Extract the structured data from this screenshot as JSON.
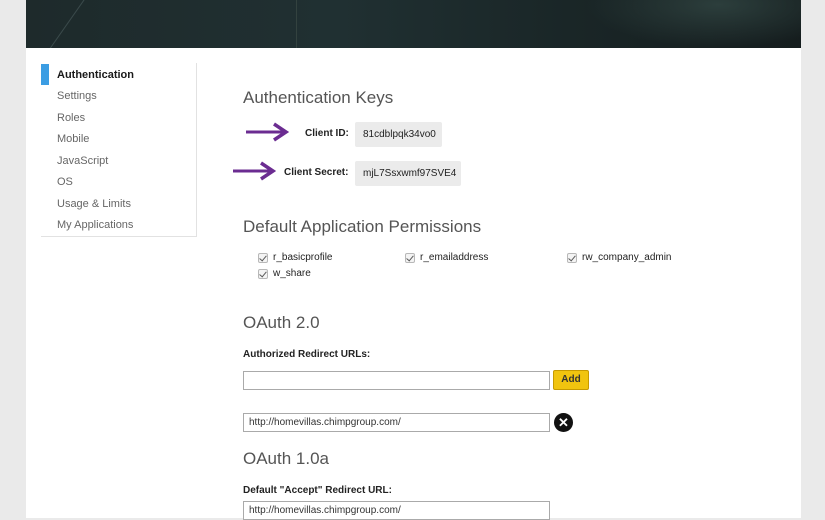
{
  "sidebar": {
    "items": [
      {
        "label": "Authentication",
        "active": true
      },
      {
        "label": "Settings"
      },
      {
        "label": "Roles"
      },
      {
        "label": "Mobile"
      },
      {
        "label": "JavaScript"
      },
      {
        "label": "OS"
      },
      {
        "label": "Usage & Limits"
      },
      {
        "label": "My Applications"
      }
    ]
  },
  "auth_keys": {
    "heading": "Authentication Keys",
    "client_id_label": "Client ID:",
    "client_id_value": "81cdblpqk34vo0",
    "client_secret_label": "Client Secret:",
    "client_secret_value": "mjL7Ssxwmf97SVE4"
  },
  "permissions": {
    "heading": "Default Application Permissions",
    "items": [
      "r_basicprofile",
      "r_emailaddress",
      "rw_company_admin",
      "w_share"
    ]
  },
  "oauth2": {
    "heading": "OAuth 2.0",
    "redirect_label": "Authorized Redirect URLs:",
    "new_url_value": "",
    "add_label": "Add",
    "saved_url": "http://homevillas.chimpgroup.com/",
    "remove_icon": "close-circle-icon"
  },
  "oauth1": {
    "heading": "OAuth 1.0a",
    "accept_label": "Default \"Accept\" Redirect URL:",
    "accept_value": "http://homevillas.chimpgroup.com/"
  },
  "colors": {
    "accent": "#3b9de3",
    "arrow": "#6b2c91",
    "add_button": "#f1c40f"
  }
}
